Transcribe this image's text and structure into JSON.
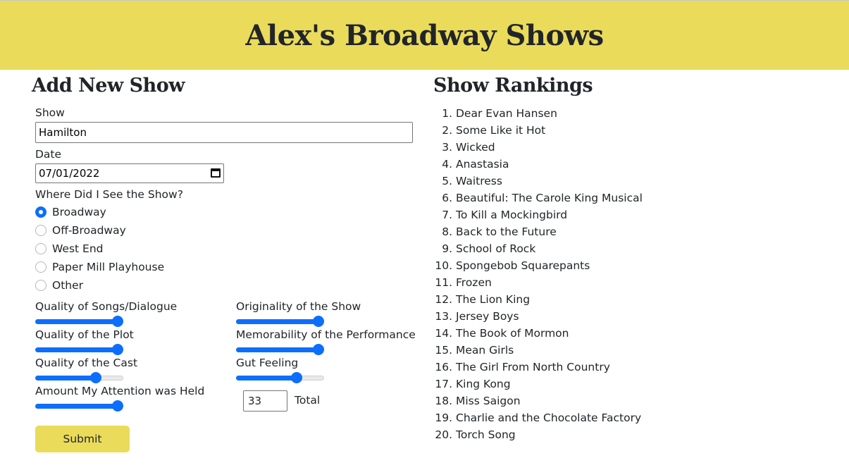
{
  "header": {
    "title": "Alex's Broadway Shows"
  },
  "form": {
    "title": "Add New Show",
    "show_label": "Show",
    "show_value": "Hamilton",
    "date_label": "Date",
    "date_value": "07/01/2022",
    "location_label": "Where Did I See the Show?",
    "locations": [
      {
        "label": "Broadway",
        "checked": true
      },
      {
        "label": "Off-Broadway",
        "checked": false
      },
      {
        "label": "West End",
        "checked": false
      },
      {
        "label": "Paper Mill Playhouse",
        "checked": false
      },
      {
        "label": "Other",
        "checked": false
      }
    ],
    "ratings": [
      {
        "label": "Quality of Songs/Dialogue",
        "value": 1.0
      },
      {
        "label": "Quality of the Plot",
        "value": 1.0
      },
      {
        "label": "Quality of the Cast",
        "value": 0.72
      },
      {
        "label": "Amount My Attention was Held",
        "value": 1.0
      },
      {
        "label": "Originality of the Show",
        "value": 1.0
      },
      {
        "label": "Memorability of the Performance",
        "value": 1.0
      },
      {
        "label": "Gut Feeling",
        "value": 0.72
      }
    ],
    "total_value": "33",
    "total_label": "Total",
    "submit_label": "Submit"
  },
  "rankings": {
    "title": "Show Rankings",
    "items": [
      "Dear Evan Hansen",
      "Some Like it Hot",
      "Wicked",
      "Anastasia",
      "Waitress",
      "Beautiful: The Carole King Musical",
      "To Kill a Mockingbird",
      "Back to the Future",
      "School of Rock",
      "Spongebob Squarepants",
      "Frozen",
      "The Lion King",
      "Jersey Boys",
      "The Book of Mormon",
      "Mean Girls",
      "The Girl From North Country",
      "King Kong",
      "Miss Saigon",
      "Charlie and the Chocolate Factory",
      "Torch Song"
    ]
  },
  "colors": {
    "accent": "#eadb5b",
    "control": "#0d6efd"
  }
}
